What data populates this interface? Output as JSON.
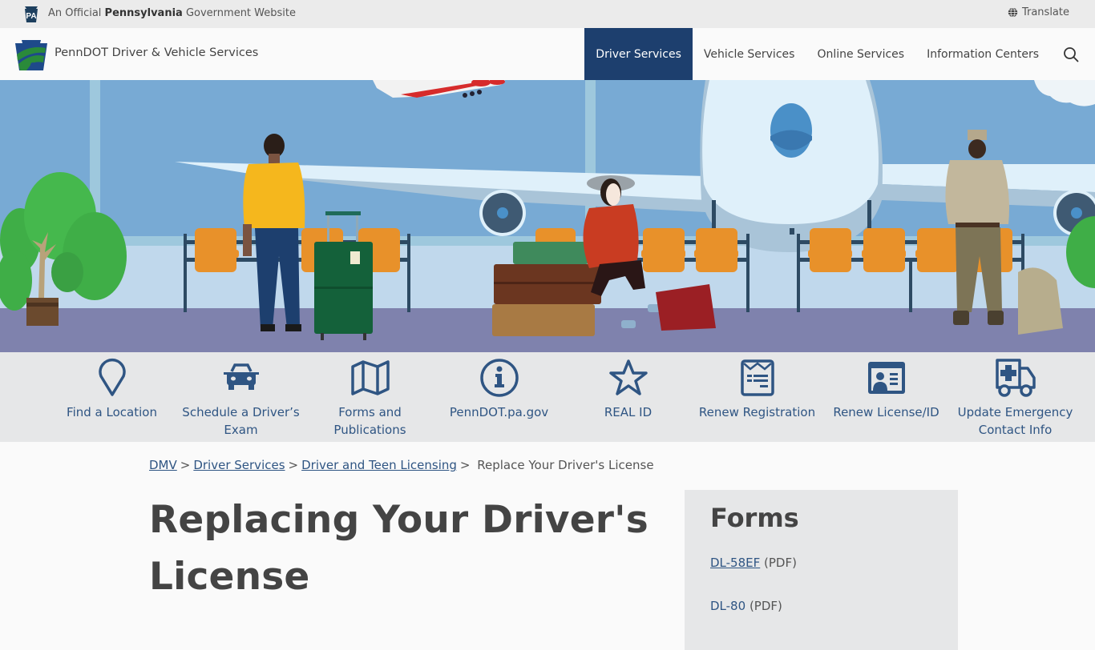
{
  "gov_banner": {
    "badge": "PA",
    "text_prefix": "An Official",
    "text_bold": "Pennsylvania",
    "text_suffix": "Government Website",
    "translate_label": "Translate"
  },
  "header": {
    "site_name": "PennDOT Driver & Vehicle Services",
    "nav": [
      {
        "label": "Driver Services",
        "active": true
      },
      {
        "label": "Vehicle Services",
        "active": false
      },
      {
        "label": "Online Services",
        "active": false
      },
      {
        "label": "Information Centers",
        "active": false
      }
    ]
  },
  "quick_links": [
    {
      "label": "Find a Location",
      "icon": "map-pin-icon"
    },
    {
      "label": "Schedule a Driver’s Exam",
      "icon": "car-icon"
    },
    {
      "label": "Forms and Publications",
      "icon": "map-icon"
    },
    {
      "label": "PennDOT.pa.gov",
      "icon": "info-icon"
    },
    {
      "label": "REAL ID",
      "icon": "star-icon"
    },
    {
      "label": "Renew Registration",
      "icon": "registration-icon"
    },
    {
      "label": "Renew License/ID",
      "icon": "id-card-icon"
    },
    {
      "label": "Update Emergency Contact Info",
      "icon": "ambulance-icon"
    }
  ],
  "breadcrumb": {
    "items": [
      "DMV",
      "Driver Services",
      "Driver and Teen Licensing"
    ],
    "current": "Replace Your Driver's License",
    "separator": ">"
  },
  "main": {
    "title": "Replacing Your Driver's License"
  },
  "sidebar": {
    "title": "Forms",
    "forms": [
      {
        "name": "DL-58EF",
        "type": "(PDF)"
      },
      {
        "name": "DL-80",
        "type": "(PDF)"
      }
    ]
  },
  "colors": {
    "brand_navy": "#1d3f6e",
    "link_blue": "#2f5583",
    "logo_green": "#2a8a3a",
    "panel_gray": "#e6e7e8"
  }
}
